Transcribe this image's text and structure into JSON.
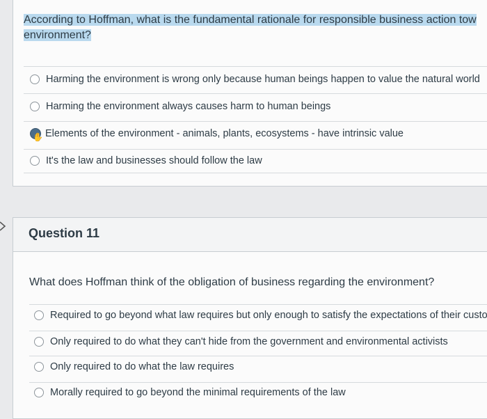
{
  "question10": {
    "text_line1": "According to Hoffman, what is the fundamental rationale for responsible business action tow",
    "text_line2": "environment?",
    "options": [
      "Harming the environment is wrong only because human beings happen to value the natural world",
      "Harming the environment always causes harm to human beings",
      "Elements of the environment - animals, plants, ecosystems - have intrinsic value",
      "It's the law and businesses should follow the law"
    ],
    "selected_index": 2
  },
  "question11": {
    "title": "Question 11",
    "text": "What does Hoffman think of the obligation of business regarding the environment?",
    "options": [
      "Required to go beyond what law requires but only enough to satisfy the expectations of their customers",
      "Only required to do what they can't hide from the government and environmental activists",
      "Only required to do what the law requires",
      "Morally required to go beyond the minimal requirements of the law"
    ]
  },
  "icons": {
    "nav_arrow": "chevron-right-icon",
    "cursor": "hand-pointer-icon"
  }
}
